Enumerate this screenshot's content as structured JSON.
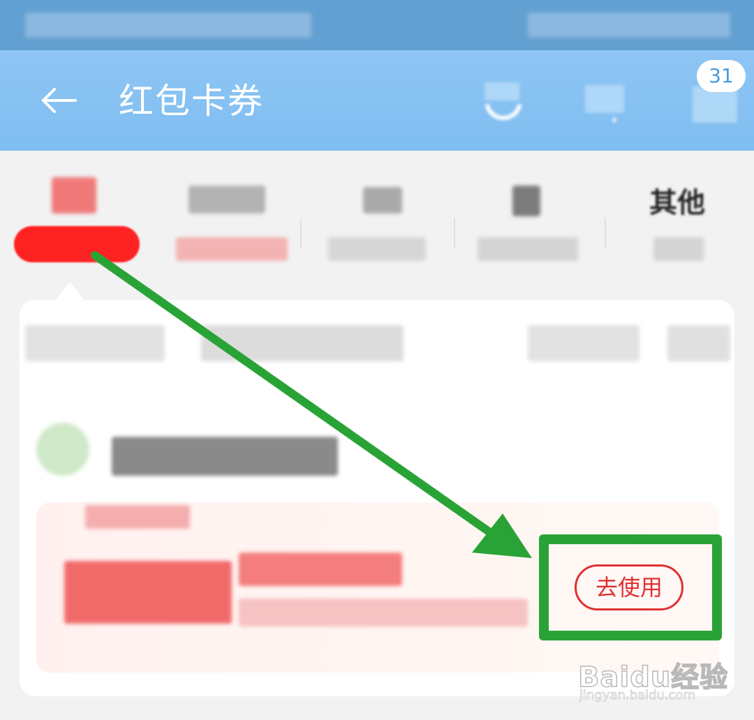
{
  "status_bar": {
    "redacted": true
  },
  "header": {
    "back_icon": "arrow-left-icon",
    "title": "红包卡券",
    "message_badge": "31",
    "colors": {
      "background": "#8ec6f4",
      "title": "#ffffff"
    }
  },
  "tabs": {
    "items": [
      {
        "label": "",
        "icon": "red-tag-icon",
        "redacted": true
      },
      {
        "label": "",
        "redacted": true
      },
      {
        "label": "",
        "redacted": true
      },
      {
        "label": "",
        "redacted": true
      },
      {
        "label": "其他",
        "redacted": true
      }
    ]
  },
  "coupon": {
    "redacted_fields": [
      "merchant_name",
      "amount",
      "coupon_title",
      "validity"
    ],
    "use_button_label": "去使用",
    "accent_color": "#e03030"
  },
  "annotation": {
    "arrow_color": "#2aa336",
    "highlight_target": "use-button"
  },
  "watermark": {
    "brand": "Baidu经验",
    "url": "jingyan.baidu.com"
  }
}
